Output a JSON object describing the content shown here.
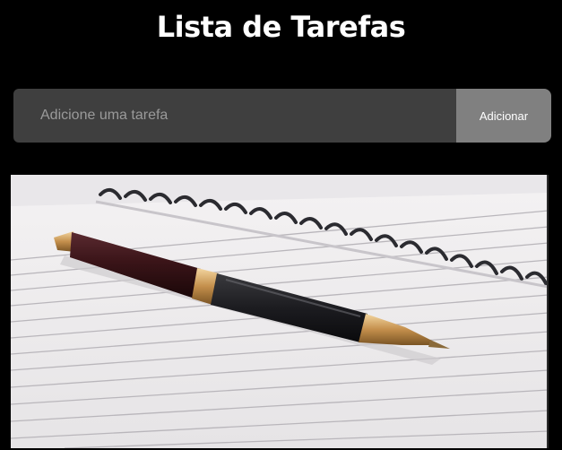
{
  "header": {
    "title": "Lista de Tarefas"
  },
  "task_form": {
    "placeholder": "Adicione uma tarefa",
    "value": "",
    "add_button_label": "Adicionar"
  },
  "illustration": {
    "subject": "notebook-and-pen"
  },
  "colors": {
    "background": "#000000",
    "input_bg": "#3f3f3f",
    "button_bg": "#808080",
    "title_text": "#ffffff"
  }
}
